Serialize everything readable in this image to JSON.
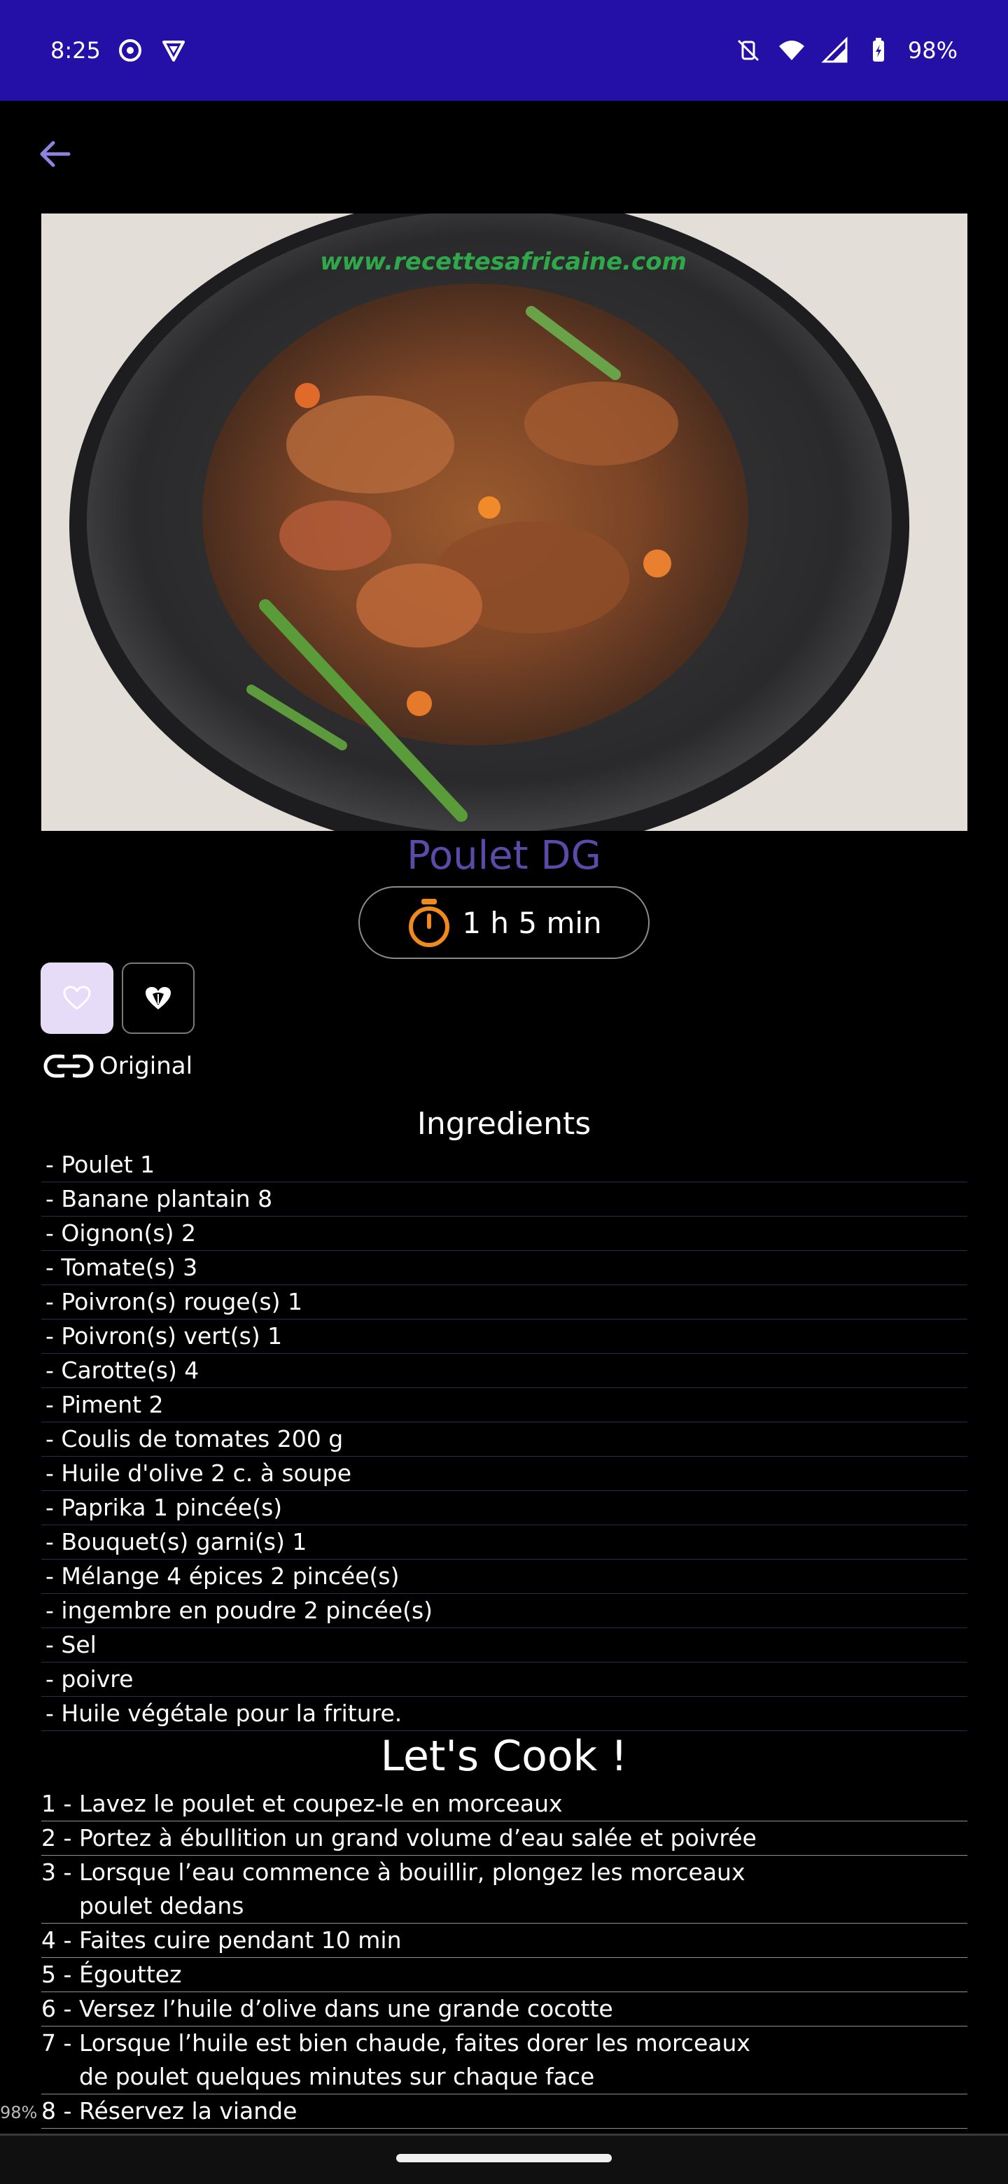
{
  "status_bar": {
    "time": "8:25",
    "battery": "98%",
    "color": "#2410a6"
  },
  "recipe": {
    "image_watermark": "www.recettesafricaine.com",
    "title": "Poulet DG",
    "time": "1 h 5 min",
    "original_label": "Original",
    "title_color": "#5b4ba8",
    "timer_color": "#f08a1c"
  },
  "ingredients": {
    "heading": "Ingredients",
    "items": [
      "- Poulet 1",
      "- Banane plantain 8",
      "- Oignon(s) 2",
      "- Tomate(s) 3",
      "- Poivron(s) rouge(s) 1",
      "- Poivron(s) vert(s) 1",
      "- Carotte(s) 4",
      "- Piment 2",
      "- Coulis de tomates 200 g",
      "- Huile d'olive 2 c. à soupe",
      "- Paprika 1 pincée(s)",
      "- Bouquet(s) garni(s) 1",
      "- Mélange 4 épices 2 pincée(s)",
      "- ingembre en poudre 2 pincée(s)",
      "- Sel",
      "- poivre",
      "- Huile végétale pour la friture."
    ]
  },
  "steps": {
    "heading": "Let's Cook !",
    "items": [
      {
        "num": "1 -",
        "text": "Lavez le poulet et coupez-le en morceaux"
      },
      {
        "num": "2 -",
        "text": "Portez à ébullition un grand volume d’eau salée et poivrée"
      },
      {
        "num": "3 -",
        "text": "Lorsque l’eau commence à bouillir, plongez les morceaux poulet dedans"
      },
      {
        "num": "4 -",
        "text": "Faites cuire pendant 10 min"
      },
      {
        "num": "5 -",
        "text": "Égouttez"
      },
      {
        "num": "6 -",
        "text": "Versez l’huile d’olive dans une grande cocotte"
      },
      {
        "num": "7 -",
        "text": "Lorsque l’huile est bien chaude, faites dorer les morceaux de poulet quelques minutes sur chaque face"
      },
      {
        "num": "8 -",
        "text": "Réservez la viande"
      }
    ]
  },
  "scroll_indicator": "98%"
}
